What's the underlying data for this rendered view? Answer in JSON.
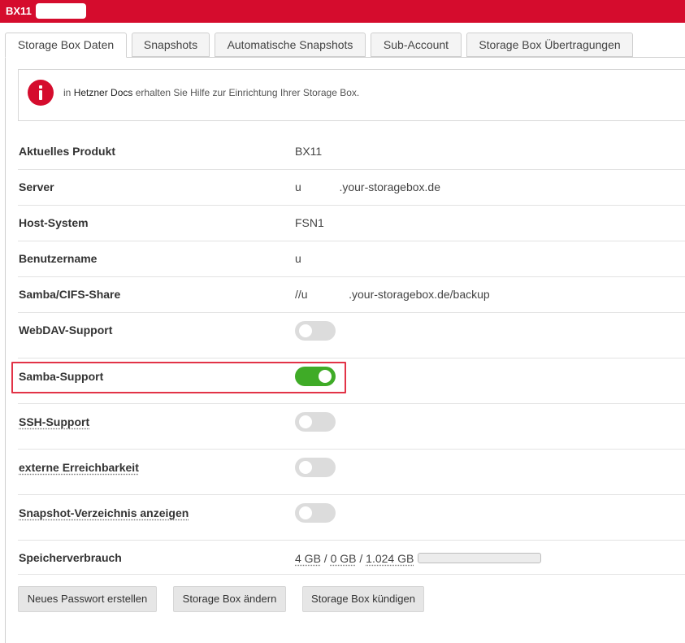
{
  "header": {
    "title": "BX11"
  },
  "tabs": [
    {
      "label": "Storage Box Daten",
      "active": true
    },
    {
      "label": "Snapshots"
    },
    {
      "label": "Automatische Snapshots"
    },
    {
      "label": "Sub-Account"
    },
    {
      "label": "Storage Box Übertragungen"
    }
  ],
  "info": {
    "icon": "info-icon",
    "prefix": "in",
    "link": "Hetzner Docs",
    "text": "erhalten Sie Hilfe zur Einrichtung Ihrer Storage Box."
  },
  "details": {
    "product": {
      "label": "Aktuelles Produkt",
      "value": "BX11"
    },
    "server": {
      "label": "Server",
      "value": "u            .your-storagebox.de"
    },
    "host": {
      "label": "Host-System",
      "value": "FSN1"
    },
    "username": {
      "label": "Benutzername",
      "value": "u"
    },
    "samba_share": {
      "label": "Samba/CIFS-Share",
      "value": "//u             .your-storagebox.de/backup"
    }
  },
  "toggles": {
    "webdav": {
      "label": "WebDAV-Support",
      "on": false
    },
    "samba": {
      "label": "Samba-Support",
      "on": true
    },
    "ssh": {
      "label": "SSH-Support",
      "on": false
    },
    "external": {
      "label": "externe Erreichbarkeit",
      "on": false
    },
    "snapshot_dir": {
      "label": "Snapshot-Verzeichnis anzeigen",
      "on": false
    }
  },
  "storage": {
    "label": "Speicherverbrauch",
    "used": "4 GB",
    "sep1": " / ",
    "snapshots": "0 GB",
    "sep2": " / ",
    "total": "1.024 GB",
    "usage_fraction": 0.004
  },
  "buttons": {
    "new_password": "Neues Passwort erstellen",
    "change": "Storage Box ändern",
    "cancel": "Storage Box kündigen"
  },
  "colors": {
    "brand": "#d50c2d",
    "toggle_on": "#3fab27",
    "toggle_off": "#dcdcdc",
    "highlight": "#e23347"
  }
}
